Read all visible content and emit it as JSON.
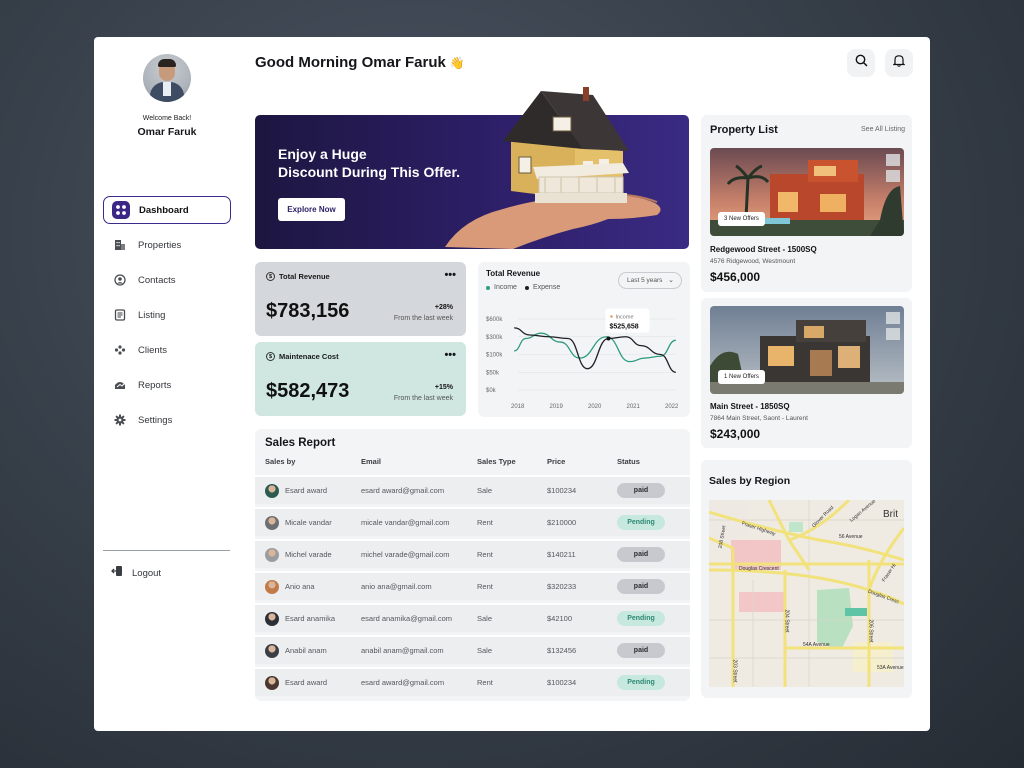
{
  "user": {
    "welcome": "Welcome Back!",
    "name": "Omar Faruk"
  },
  "greeting": "Good Morning Omar Faruk",
  "greeting_emoji": "👋",
  "nav": {
    "items": [
      {
        "label": "Dashboard",
        "icon": "dashboard-icon",
        "active": true
      },
      {
        "label": "Properties",
        "icon": "building-icon"
      },
      {
        "label": "Contacts",
        "icon": "user-circle-icon"
      },
      {
        "label": "Listing",
        "icon": "list-icon"
      },
      {
        "label": "Clients",
        "icon": "clients-icon"
      },
      {
        "label": "Reports",
        "icon": "reports-icon"
      },
      {
        "label": "Settings",
        "icon": "gear-icon"
      }
    ],
    "logout": "Logout"
  },
  "banner": {
    "title_line1": "Enjoy a Huge",
    "title_line2": "Discount During This Offer.",
    "button": "Explore Now"
  },
  "stats": {
    "revenue": {
      "label": "Total Revenue",
      "amount": "$783,156",
      "change": "+28%",
      "from": "From the last week"
    },
    "cost": {
      "label": "Maintenace Cost",
      "amount": "$582,473",
      "change": "+15%",
      "from": "From the last week"
    }
  },
  "revenue_chart": {
    "title": "Total Revenue",
    "range": "Last 5 years",
    "tooltip_label": "Income",
    "tooltip_value": "$525,658"
  },
  "chart_data": {
    "type": "line",
    "x": [
      2018,
      2019,
      2020,
      2021,
      2022
    ],
    "x_ticks": [
      "2018",
      "2019",
      "2020",
      "2021",
      "2022"
    ],
    "y_ticks": [
      "$0k",
      "$50k",
      "$100k",
      "$300k",
      "$600k"
    ],
    "series": [
      {
        "name": "Income",
        "color": "#2e9c80",
        "points": [
          [
            2017.9,
            2.2
          ],
          [
            2018.2,
            2.9
          ],
          [
            2018.6,
            3.2
          ],
          [
            2019.1,
            2.7
          ],
          [
            2019.6,
            1.8
          ],
          [
            2020.3,
            3.0
          ],
          [
            2020.9,
            1.6
          ],
          [
            2021.3,
            1.8
          ],
          [
            2021.7,
            1.9
          ],
          [
            2022.1,
            2.8
          ]
        ]
      },
      {
        "name": "Expense",
        "color": "#1d2026",
        "points": [
          [
            2017.9,
            3.5
          ],
          [
            2018.3,
            3.1
          ],
          [
            2018.8,
            3.0
          ],
          [
            2019.3,
            2.9
          ],
          [
            2019.8,
            1.2
          ],
          [
            2020.35,
            2.9
          ],
          [
            2020.8,
            3.0
          ],
          [
            2021.2,
            2.5
          ],
          [
            2021.7,
            2.0
          ],
          [
            2022.1,
            1.0
          ]
        ]
      }
    ],
    "grid": true,
    "legend": "top-left"
  },
  "sales_report": {
    "title": "Sales Report",
    "columns": [
      "Sales by",
      "Email",
      "Sales Type",
      "Price",
      "Status"
    ],
    "rows": [
      {
        "name": "Esard award",
        "email": "esard award@gmail.com",
        "type": "Sale",
        "price": "$100234",
        "status": "paid"
      },
      {
        "name": "Micale vandar",
        "email": "micale vandar@gmail.com",
        "type": "Rent",
        "price": "$210000",
        "status": "Pending"
      },
      {
        "name": "Michel varade",
        "email": "michel varade@gmail.com",
        "type": "Rent",
        "price": "$140211",
        "status": "paid"
      },
      {
        "name": "Anio ana",
        "email": "anio ana@gmail.com",
        "type": "Rent",
        "price": "$320233",
        "status": "paid"
      },
      {
        "name": "Esard anamika",
        "email": "esard anamika@gmail.com",
        "type": "Sale",
        "price": "$42100",
        "status": "Pending"
      },
      {
        "name": "Anabil anam",
        "email": "anabil anam@gmail.com",
        "type": "Sale",
        "price": "$132456",
        "status": "paid"
      },
      {
        "name": "Esard award",
        "email": "esard award@gmail.com",
        "type": "Rent",
        "price": "$100234",
        "status": "Pending"
      }
    ]
  },
  "property_list": {
    "title": "Property List",
    "see_all": "See All Listing",
    "items": [
      {
        "offers": "3 New Offers",
        "name": "Redgewood Street - 1500SQ",
        "address": "4576 Ridgewood, Westmount",
        "price": "$456,000"
      },
      {
        "offers": "1 New Offers",
        "name": "Main Street - 1850SQ",
        "address": "7864 Main Street, Saont - Laurent",
        "price": "$243,000"
      }
    ]
  },
  "sales_by_region": {
    "title": "Sales by Region",
    "map_labels": [
      "Brit",
      "Fraser Highway",
      "Glover Road",
      "Logan Avenue",
      "56 Avenue",
      "Douglas Crescent",
      "Douglas Cresc",
      "Fraser Hi",
      "208 Street",
      "204 Street",
      "206 Street",
      "54A Avenue",
      "53A Avenue",
      "203 Street"
    ]
  }
}
